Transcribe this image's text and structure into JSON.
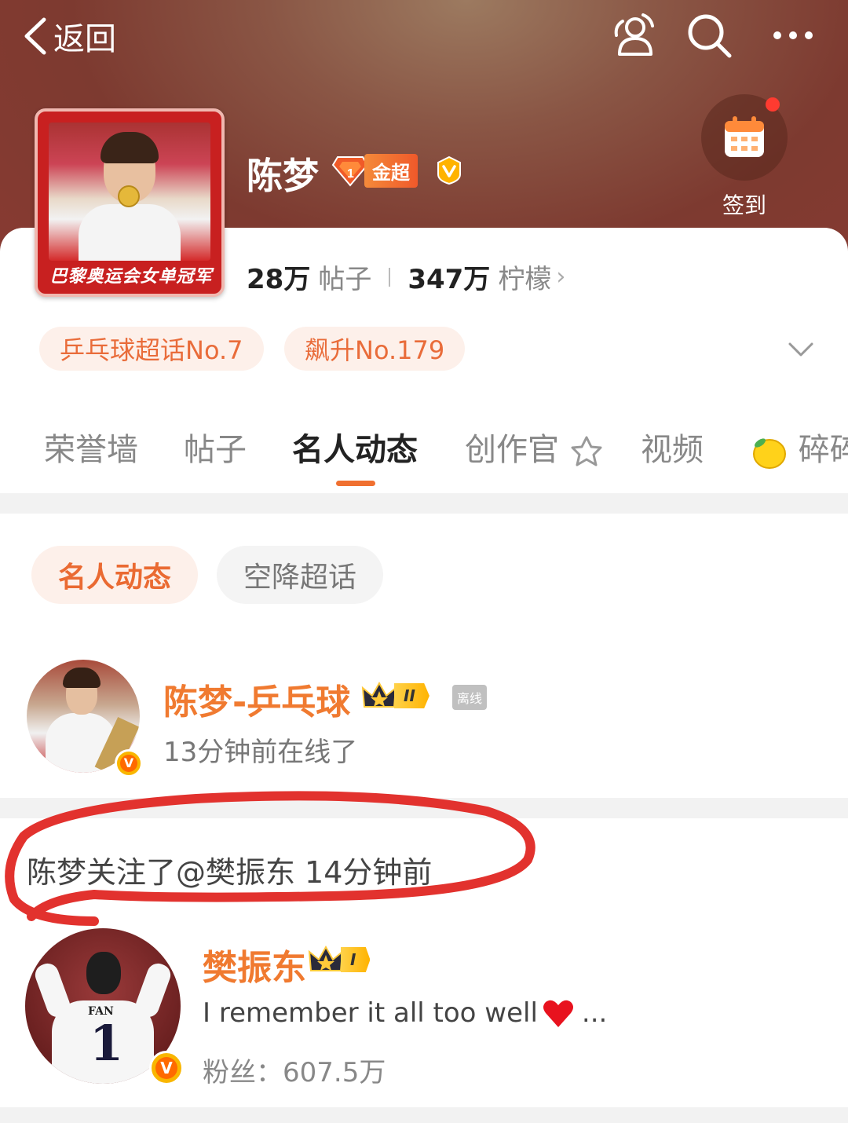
{
  "nav": {
    "back_label": "返回"
  },
  "profile": {
    "avatar_caption": "巴黎奥运会女单冠军",
    "name": "陈梦",
    "gold_badge_label": "金超",
    "checkin_label": "签到"
  },
  "stats": {
    "posts_count": "28万",
    "posts_label": "帖子",
    "lemons_count": "347万",
    "lemons_label": "柠檬",
    "more_arrow": "›"
  },
  "ranks": [
    {
      "label": "乒乓球超话No.7"
    },
    {
      "label": "飙升No.179"
    }
  ],
  "tabs": [
    {
      "label": "荣誉墙"
    },
    {
      "label": "帖子"
    },
    {
      "label": "名人动态"
    },
    {
      "label": "创作官"
    },
    {
      "label": "视频"
    },
    {
      "label": "碎碎"
    }
  ],
  "sub_tabs": [
    {
      "label": "名人动态"
    },
    {
      "label": "空降超话"
    }
  ],
  "user1": {
    "name": "陈梦-乒乓球",
    "level": "II",
    "status_tag": "离线",
    "subtitle": "13分钟前在线了"
  },
  "activity": {
    "text": "陈梦关注了@樊振东",
    "time": "14分钟前"
  },
  "user2": {
    "name": "樊振东",
    "level": "I",
    "jersey_name": "FAN",
    "jersey_number": "1",
    "bio": "I remember it all too well",
    "bio_ellipsis": "...",
    "fans_label": "粉丝：",
    "fans_count": "607.5万"
  },
  "colors": {
    "accent": "#f07030",
    "username": "#f07a30",
    "pill_bg": "#fdf0ea",
    "annotation_red": "#e2322e"
  },
  "icons": {
    "back": "chevron-left-icon",
    "people": "people-icon",
    "search": "search-icon",
    "more": "more-dots-icon",
    "checkin": "calendar-icon",
    "expand": "chevron-down-icon",
    "lemon": "lemon-icon",
    "creator": "creator-badge-icon",
    "heart": "heart-icon",
    "crown": "crown-icon",
    "verified": "verified-v-icon"
  }
}
